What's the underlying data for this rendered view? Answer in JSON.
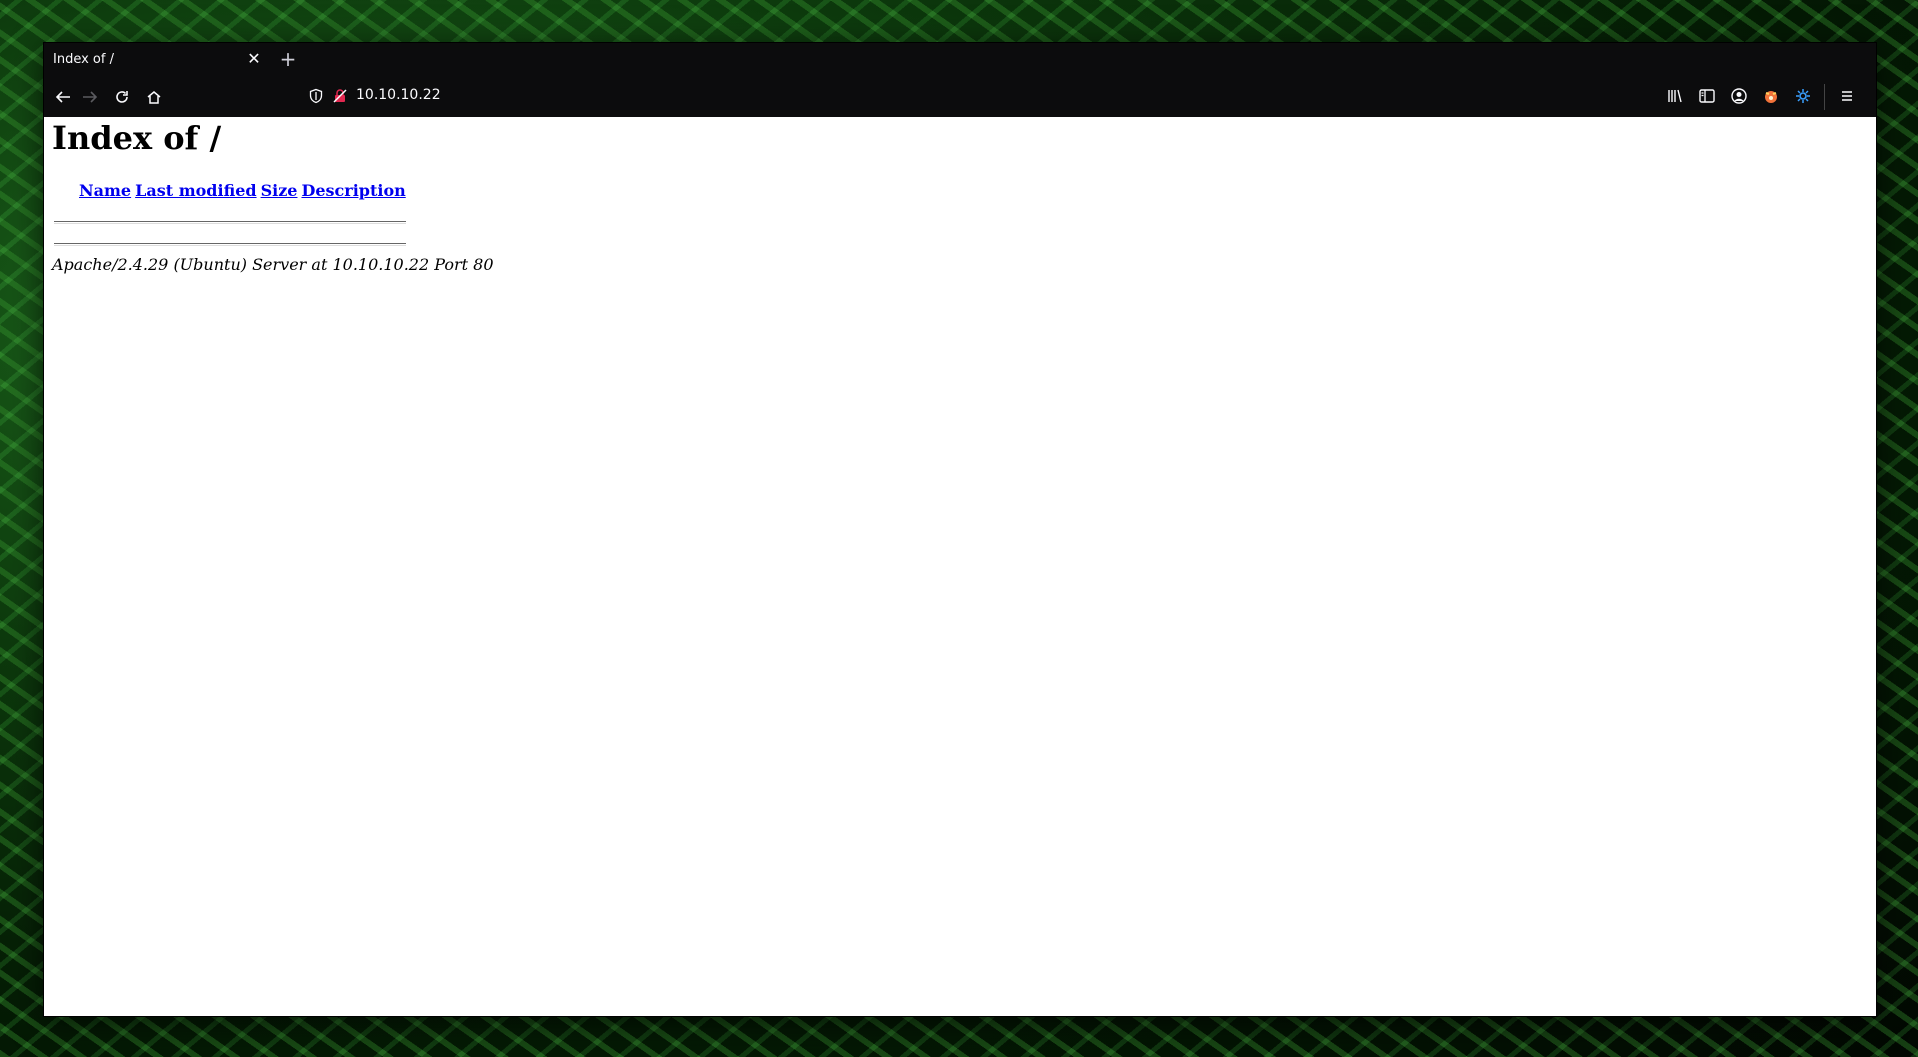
{
  "browser": {
    "tab_title": "Index of /",
    "tab_close_icon": "close-icon",
    "new_tab_icon": "plus-icon",
    "url": "10.10.10.22",
    "nav": [
      "back-arrow-icon",
      "forward-arrow-icon",
      "reload-icon",
      "home-icon"
    ],
    "right_icons": [
      "library-icon",
      "sidebar-icon",
      "account-icon",
      "extension-fox-icon",
      "extension-gear-icon",
      "menu-icon"
    ]
  },
  "page": {
    "title": "Index of /",
    "columns": [
      "Name",
      "Last modified",
      "Size",
      "Description"
    ],
    "rows": [],
    "footer": "Apache/2.4.29 (Ubuntu) Server at 10.10.10.22 Port 80"
  },
  "colors": {
    "link": "#0000ee",
    "chrome": "#0c0c0d",
    "page_bg": "#ffffff"
  }
}
